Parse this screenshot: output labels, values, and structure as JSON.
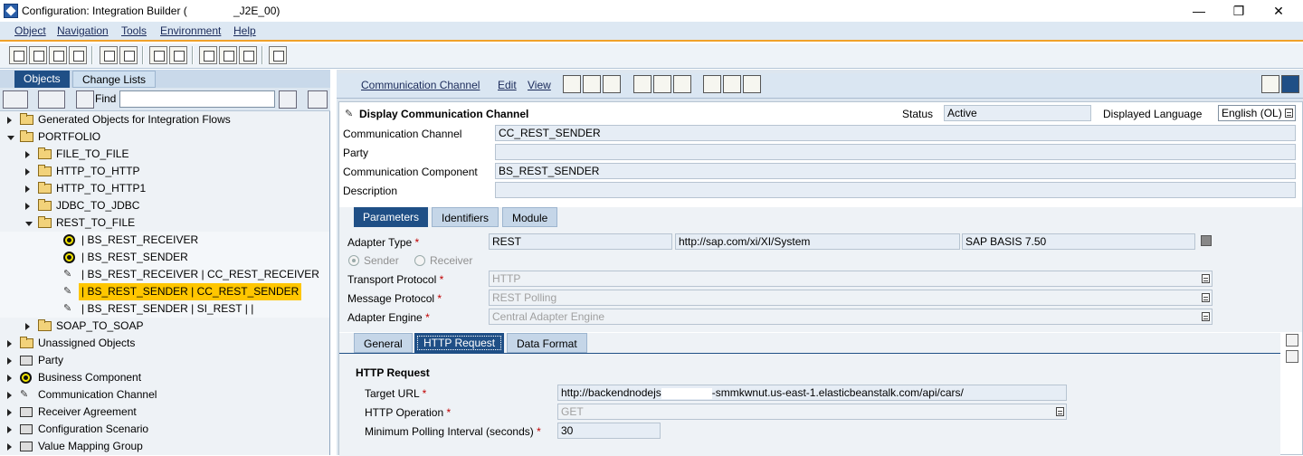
{
  "window": {
    "title": "Configuration: Integration Builder (",
    "title_suffix": "_J2E_00)",
    "minimize": "—",
    "restore": "❐",
    "close": "✕"
  },
  "menu": [
    "Object",
    "Navigation",
    "Tools",
    "Environment",
    "Help"
  ],
  "left": {
    "tabs": [
      "Objects",
      "Change Lists"
    ],
    "find_label": "Find",
    "find_value": "",
    "tree": [
      {
        "label": "Generated Objects for Integration Flows",
        "icon": "folder-icon",
        "level": 0,
        "expanded": false
      },
      {
        "label": "PORTFOLIO",
        "icon": "folder-open-icon",
        "level": 0,
        "expanded": true
      },
      {
        "label": "FILE_TO_FILE",
        "icon": "folder-icon",
        "level": 1,
        "expanded": false
      },
      {
        "label": "HTTP_TO_HTTP",
        "icon": "folder-icon",
        "level": 1,
        "expanded": false
      },
      {
        "label": "HTTP_TO_HTTP1",
        "icon": "folder-icon",
        "level": 1,
        "expanded": false
      },
      {
        "label": "JDBC_TO_JDBC",
        "icon": "folder-icon",
        "level": 1,
        "expanded": false
      },
      {
        "label": "REST_TO_FILE",
        "icon": "folder-open-icon",
        "level": 1,
        "expanded": true
      },
      {
        "label": "| BS_REST_RECEIVER",
        "icon": "component-icon",
        "level": 2
      },
      {
        "label": "| BS_REST_SENDER",
        "icon": "component-icon",
        "level": 2
      },
      {
        "label": "| BS_REST_RECEIVER | CC_REST_RECEIVER",
        "icon": "channel-icon",
        "level": 2
      },
      {
        "label": "| BS_REST_SENDER | CC_REST_SENDER",
        "icon": "channel-icon",
        "level": 2,
        "selected": true
      },
      {
        "label": "| BS_REST_SENDER | SI_REST | |",
        "icon": "sender-agreement-icon",
        "level": 2
      },
      {
        "label": "SOAP_TO_SOAP",
        "icon": "folder-icon",
        "level": 1,
        "expanded": false
      },
      {
        "label": "Unassigned Objects",
        "icon": "folder-icon",
        "level": 0,
        "expanded": false
      },
      {
        "label": "Party",
        "icon": "party-icon",
        "level": 0,
        "expanded": false
      },
      {
        "label": "Business Component",
        "icon": "component-icon",
        "level": 0,
        "expanded": false
      },
      {
        "label": "Communication Channel",
        "icon": "channel-icon",
        "level": 0,
        "expanded": false
      },
      {
        "label": "Receiver Agreement",
        "icon": "agreement-icon",
        "level": 0,
        "expanded": false
      },
      {
        "label": "Configuration Scenario",
        "icon": "scenario-icon",
        "level": 0,
        "expanded": false
      },
      {
        "label": "Value Mapping Group",
        "icon": "mapping-icon",
        "level": 0,
        "expanded": false
      }
    ]
  },
  "right": {
    "menu": [
      "Communication Channel",
      "Edit",
      "View"
    ],
    "header": {
      "title": "Display Communication Channel",
      "status_label": "Status",
      "status_value": "Active",
      "lang_label": "Displayed Language",
      "lang_value": "English (OL)"
    },
    "fields": {
      "channel_label": "Communication Channel",
      "channel_value": "CC_REST_SENDER",
      "party_label": "Party",
      "party_value": "",
      "component_label": "Communication Component",
      "component_value": "BS_REST_SENDER",
      "description_label": "Description",
      "description_value": ""
    },
    "tabs": [
      "Parameters",
      "Identifiers",
      "Module"
    ],
    "params": {
      "adapter_type_label": "Adapter Type",
      "adapter_type": "REST",
      "adapter_namespace": "http://sap.com/xi/XI/System",
      "adapter_swcv": "SAP BASIS 7.50",
      "sender_label": "Sender",
      "receiver_label": "Receiver",
      "transport_label": "Transport Protocol",
      "transport_value": "HTTP",
      "message_label": "Message Protocol",
      "message_value": "REST Polling",
      "engine_label": "Adapter Engine",
      "engine_value": "Central Adapter Engine"
    },
    "subtabs": [
      "General",
      "HTTP Request",
      "Data Format"
    ],
    "http": {
      "section_title": "HTTP Request",
      "url_label": "Target URL",
      "url_value_a": "http://backendnodejs",
      "url_value_b": "-smmkwnut.us-east-1.elasticbeanstalk.com/api/cars/",
      "op_label": "HTTP Operation",
      "op_value": "GET",
      "interval_label": "Minimum Polling Interval (seconds)",
      "interval_value": "30"
    },
    "required_mark": "*"
  }
}
